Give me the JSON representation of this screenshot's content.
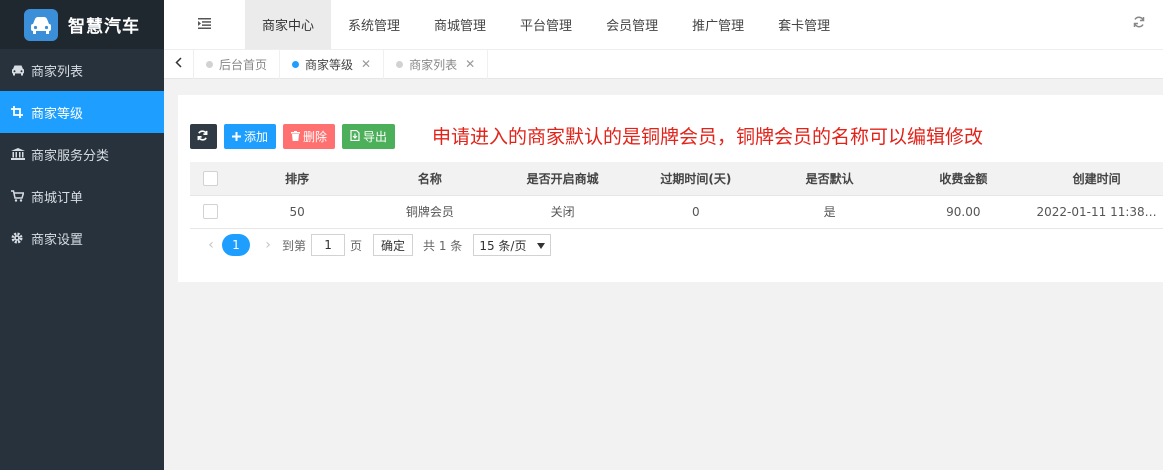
{
  "app": {
    "title": "智慧汽车"
  },
  "sidebar": {
    "items": [
      {
        "label": "商家列表",
        "icon": "car-icon",
        "active": false
      },
      {
        "label": "商家等级",
        "icon": "crop-icon",
        "active": true
      },
      {
        "label": "商家服务分类",
        "icon": "bank-icon",
        "active": false
      },
      {
        "label": "商城订单",
        "icon": "cart-icon",
        "active": false
      },
      {
        "label": "商家设置",
        "icon": "gear-icon",
        "active": false
      }
    ]
  },
  "topnav": {
    "tabs": [
      {
        "label": "商家中心",
        "active": true
      },
      {
        "label": "系统管理",
        "active": false
      },
      {
        "label": "商城管理",
        "active": false
      },
      {
        "label": "平台管理",
        "active": false
      },
      {
        "label": "会员管理",
        "active": false
      },
      {
        "label": "推广管理",
        "active": false
      },
      {
        "label": "套卡管理",
        "active": false
      }
    ]
  },
  "pagetabs": [
    {
      "label": "后台首页",
      "active": false,
      "closable": false
    },
    {
      "label": "商家等级",
      "active": true,
      "closable": true
    },
    {
      "label": "商家列表",
      "active": false,
      "closable": true
    }
  ],
  "toolbar": {
    "add_label": "添加",
    "delete_label": "删除",
    "export_label": "导出"
  },
  "annotation": "申请进入的商家默认的是铜牌会员，铜牌会员的名称可以编辑修改",
  "table": {
    "columns": [
      "排序",
      "名称",
      "是否开启商城",
      "过期时间(天)",
      "是否默认",
      "收费金额",
      "创建时间"
    ],
    "rows": [
      [
        "50",
        "铜牌会员",
        "关闭",
        "0",
        "是",
        "90.00",
        "2022-01-11 11:38…"
      ]
    ]
  },
  "pager": {
    "current": "1",
    "goto_prefix": "到第",
    "goto_value": "1",
    "goto_suffix": "页",
    "confirm_label": "确定",
    "total": "共 1 条",
    "page_size": "15 条/页"
  },
  "colors": {
    "accent": "#1e9fff",
    "sidebar": "#28323d",
    "danger": "#ff7070",
    "success": "#4cb05a",
    "annotation": "#e2231a"
  }
}
